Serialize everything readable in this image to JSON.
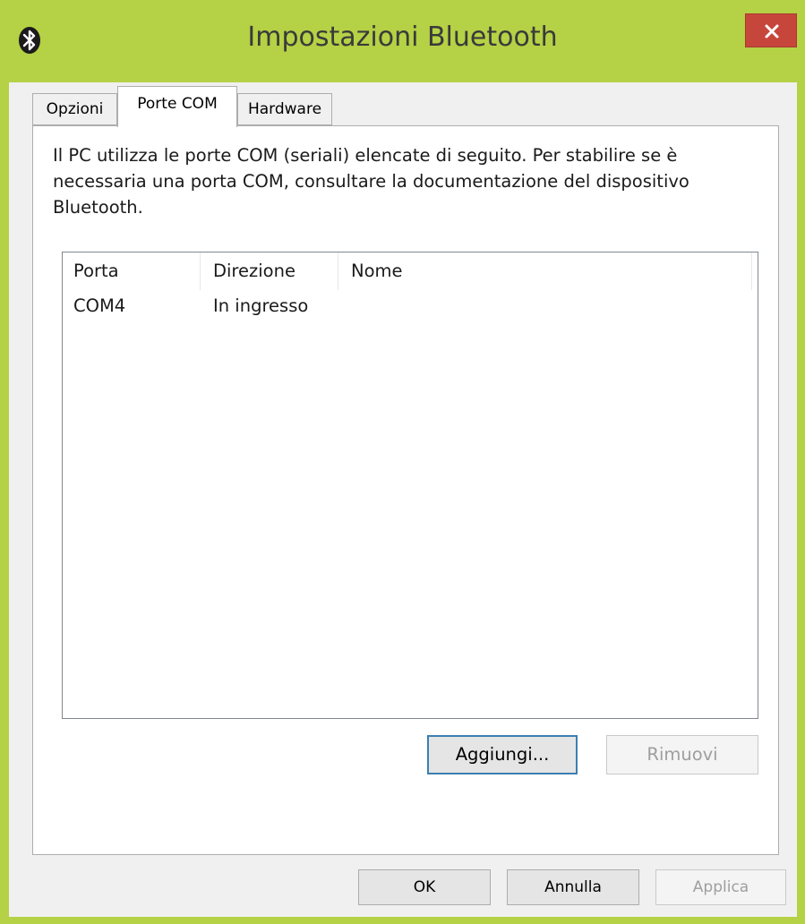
{
  "window": {
    "title": "Impostazioni Bluetooth",
    "accent_color": "#b5d145",
    "close_color": "#c7463b"
  },
  "tabs": [
    {
      "label": "Opzioni",
      "selected": false
    },
    {
      "label": "Porte COM",
      "selected": true
    },
    {
      "label": "Hardware",
      "selected": false
    }
  ],
  "com_ports": {
    "description": "Il PC utilizza le porte COM (seriali) elencate di seguito. Per stabilire se è necessaria una porta COM, consultare la documentazione del dispositivo Bluetooth.",
    "columns": [
      "Porta",
      "Direzione",
      "Nome"
    ],
    "rows": [
      {
        "porta": "COM4",
        "direzione": "In ingresso",
        "nome": ""
      }
    ],
    "add_label": "Aggiungi...",
    "remove_label": "Rimuovi"
  },
  "footer": {
    "ok_label": "OK",
    "cancel_label": "Annulla",
    "apply_label": "Applica"
  },
  "icons": {
    "app": "bluetooth-icon",
    "close": "close-icon"
  }
}
